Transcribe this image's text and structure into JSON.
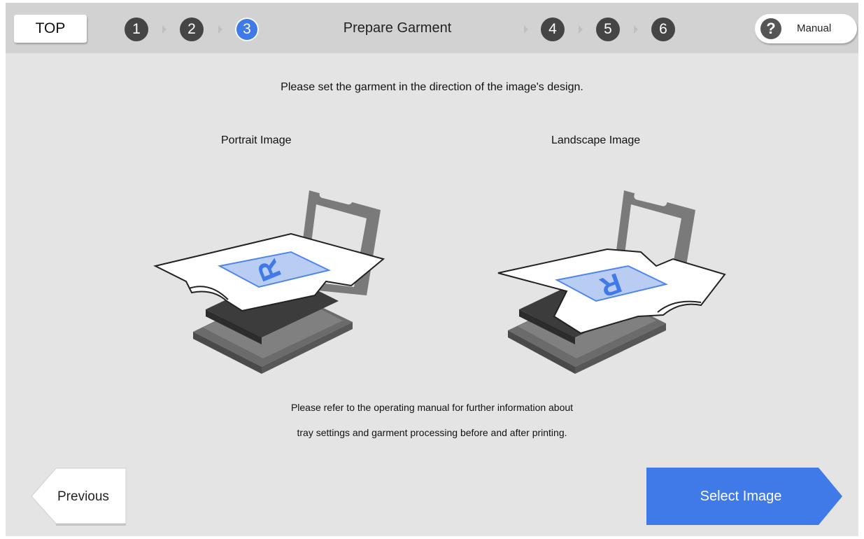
{
  "header": {
    "top_label": "TOP",
    "steps": [
      "1",
      "2",
      "3",
      "4",
      "5",
      "6"
    ],
    "current_step": "3",
    "step_title": "Prepare Garment",
    "manual_label": "Manual",
    "manual_icon": "question-icon"
  },
  "main": {
    "instruction": "Please set the garment in the direction of the image's design.",
    "portrait_label": "Portrait Image",
    "landscape_label": "Landscape Image",
    "design_letter": "R",
    "note_line1": "Please refer to the operating manual for further information about",
    "note_line2": "tray settings and garment processing before and after printing."
  },
  "footer": {
    "previous_label": "Previous",
    "next_label": "Select Image"
  },
  "colors": {
    "accent": "#3f7ae8",
    "step_inactive": "#454545",
    "background": "#e4e4e4",
    "header_background": "#d2d2d2"
  }
}
